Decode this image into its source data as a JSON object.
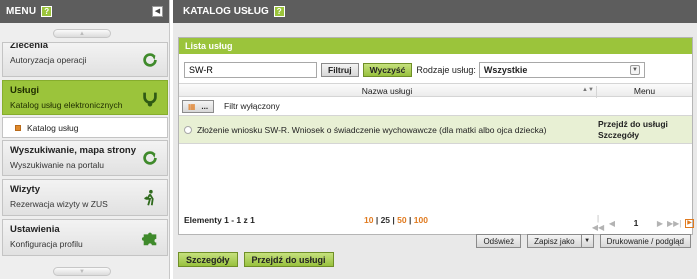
{
  "menu": {
    "title": "MENU",
    "help": "?",
    "items": [
      {
        "title": "Zlecenia",
        "subtitle": "Autoryzacja operacji",
        "icon": "refresh-icon"
      },
      {
        "title": "Usługi",
        "subtitle": "Katalog usług elektronicznych",
        "icon": "services-icon"
      },
      {
        "title": "Wyszukiwanie, mapa strony",
        "subtitle": "Wyszukiwanie na portalu",
        "icon": "refresh-icon"
      },
      {
        "title": "Wizyty",
        "subtitle": "Rezerwacja wizyty w ZUS",
        "icon": "walking-person-icon"
      },
      {
        "title": "Ustawienia",
        "subtitle": "Konfiguracja profilu",
        "icon": "puzzle-icon"
      }
    ],
    "subitem": "Katalog usług"
  },
  "content": {
    "title": "KATALOG USŁUG",
    "help": "?",
    "list_title": "Lista usług",
    "search_value": "SW-R",
    "filter_button": "Filtruj",
    "clear_button": "Wyczyść",
    "type_label": "Rodzaje usług:",
    "type_selected": "Wszystkie",
    "columns": {
      "name": "Nazwa usługi",
      "menu": "Menu"
    },
    "filter_toggle": "...",
    "filter_state": "Filtr wyłączony",
    "rows": [
      {
        "name": "Złożenie wniosku SW-R. Wniosek o świadczenie wychowawcze (dla matki albo ojca dziecka)",
        "link1": "Przejdź do usługi",
        "link2": "Szczegóły"
      }
    ],
    "pager": {
      "count": "Elementy 1 - 1 z 1",
      "sizes": [
        "10",
        "25",
        "50",
        "100"
      ],
      "current_size": "25",
      "page": "1"
    },
    "actions": {
      "refresh": "Odśwież",
      "save_as": "Zapisz jako",
      "print": "Drukowanie / podgląd"
    },
    "bottom": {
      "details": "Szczegóły",
      "goto": "Przejdź do usługi"
    }
  },
  "colors": {
    "accent_green": "#9bc43b",
    "header_dark": "#5d5d5d",
    "row_highlight": "#e8f0d4",
    "link_orange": "#e07a1f"
  }
}
